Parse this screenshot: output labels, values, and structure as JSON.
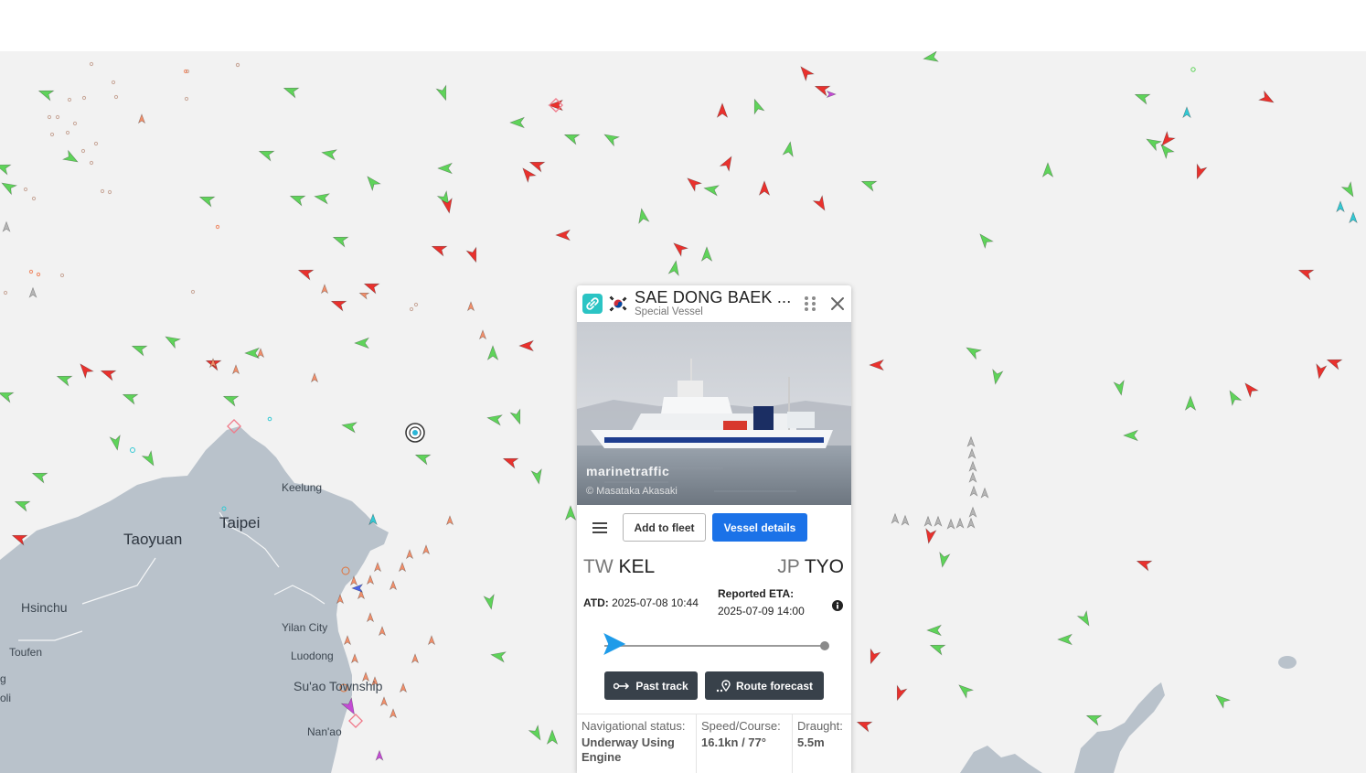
{
  "map": {
    "cities": [
      {
        "name": "Taoyuan",
        "size": "big"
      },
      {
        "name": "Taipei",
        "size": "big"
      },
      {
        "name": "Keelung",
        "size": "sm"
      },
      {
        "name": "Hsinchu",
        "size": "mid"
      },
      {
        "name": "Toufen",
        "size": "sm"
      },
      {
        "name": "Yilan City",
        "size": "sm"
      },
      {
        "name": "Luodong",
        "size": "sm"
      },
      {
        "name": "Su'ao Township",
        "size": "mid"
      },
      {
        "name": "Nan'ao",
        "size": "sm"
      },
      {
        "name": "oli",
        "size": "sm"
      },
      {
        "name": "g",
        "size": "sm"
      }
    ],
    "colors": {
      "sea": "#f2f2f2",
      "land": "#b9c2cb",
      "cargo": "#5fd35a",
      "tanker": "#e9312d",
      "passenger": "#4a63e8",
      "special": "#c34bd4",
      "fishing": "#f28f6b",
      "unknown": "#b5b5b5",
      "tug": "#33c9d4"
    }
  },
  "popup": {
    "name": "SAE DONG BAEK ...",
    "type": "Special Vessel",
    "flag_icon": "south-korea-flag",
    "photo": {
      "brand": "marinetraffic",
      "credit": "© Masataka Akasaki"
    },
    "buttons": {
      "add_fleet": "Add to fleet",
      "details": "Vessel details",
      "past_track": "Past track",
      "route_forecast": "Route forecast"
    },
    "from": {
      "country": "TW",
      "port": "KEL"
    },
    "to": {
      "country": "JP",
      "port": "TYO"
    },
    "atd": {
      "label": "ATD:",
      "value": "2025-07-08 10:44"
    },
    "eta": {
      "label": "Reported ETA:",
      "value": "2025-07-09 14:00"
    },
    "progress": 0.03,
    "info": [
      {
        "label": "Navigational status:",
        "value": "Underway Using Engine"
      },
      {
        "label": "Speed/Course:",
        "value": "16.1kn / 77°"
      },
      {
        "label": "Draught:",
        "value": "5.5m"
      }
    ]
  }
}
